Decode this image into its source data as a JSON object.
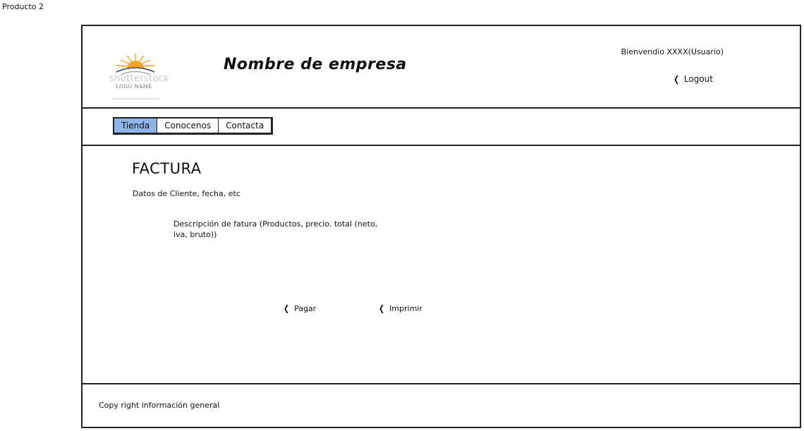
{
  "page": {
    "label": "Producto 2"
  },
  "header": {
    "logo": {
      "wordmark": "shutterstock",
      "name": "LOGO NAME"
    },
    "company_name": "Nombre de empresa",
    "welcome": "Bienvendio XXXX(Usuario)",
    "logout_label": "Logout"
  },
  "nav": {
    "tabs": [
      {
        "label": "Tienda",
        "active": true
      },
      {
        "label": "Conocenos",
        "active": false
      },
      {
        "label": "Contacta",
        "active": false
      }
    ],
    "active_color": "#8eb4ea"
  },
  "main": {
    "title": "FACTURA",
    "client_data": "Datos de Cliente, fecha, etc",
    "description": "Descripción de fatura (Productos, precio. total (neto, iva, bruto))",
    "pay_label": "Pagar",
    "print_label": "Imprimir"
  },
  "footer": {
    "text": "Copy right información general"
  },
  "icons": {
    "back": "chevron-left-icon",
    "logo": "sun-logo-icon"
  }
}
